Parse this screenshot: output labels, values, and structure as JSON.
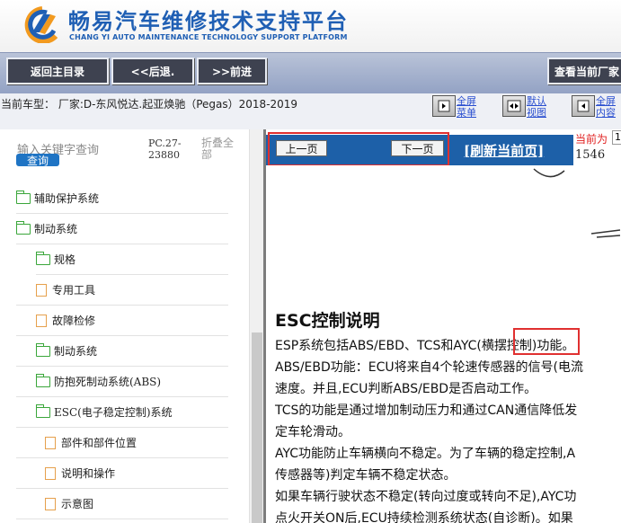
{
  "header": {
    "title_cn": "畅易汽车维修技术支持平台",
    "title_en": "CHANG YI AUTO MAINTENANCE TECHNOLOGY SUPPORT PLATFORM"
  },
  "toolbar": {
    "home_label": "返回主目录",
    "back_label": "<<后退.",
    "forward_label": ">>前进",
    "current_label": "查看当前厂家"
  },
  "infobar": {
    "model_text": "当前车型：  厂家:D-东风悦达.起亚焕驰（Pegas）2018-2019",
    "fullscreen_menu": "全屏菜单",
    "default_view": "默认视图",
    "fullscreen_content": "全屏内容"
  },
  "sidebar": {
    "search_hint": "输入关键字查询",
    "search_button": "查询",
    "pc_code": "PC.27-23880",
    "collapse_all": "折叠全部",
    "tree": [
      {
        "label": "辅助保护系统",
        "type": "folder"
      },
      {
        "label": "制动系统",
        "type": "folder"
      },
      {
        "label": "规格",
        "type": "folder"
      },
      {
        "label": "专用工具",
        "type": "file"
      },
      {
        "label": "故障检修",
        "type": "file"
      },
      {
        "label": "制动系统",
        "type": "folder"
      },
      {
        "label": "防抱死制动系统(ABS)",
        "type": "folder"
      },
      {
        "label": "ESC(电子稳定控制)系统",
        "type": "folder"
      },
      {
        "label": "部件和部件位置",
        "type": "file"
      },
      {
        "label": "说明和操作",
        "type": "file"
      },
      {
        "label": "示意图",
        "type": "file"
      }
    ]
  },
  "content": {
    "prev_button": "上一页",
    "next_button": "下一页",
    "refresh_link": "[刷新当前页]",
    "current_label": "当前为",
    "current_value": "1",
    "page_number": "1546",
    "doc_title": "ESC控制说明",
    "lines": [
      "ESP系统包括ABS/EBD、TCS和AYC(横摆控制)功能。",
      "ABS/EBD功能：ECU将来自4个轮速传感器的信号(电流",
      "速度。并且,ECU判断ABS/EBD是否启动工作。",
      "TCS的功能是通过增加制动压力和通过CAN通信降低发",
      "定车轮滑动。",
      "AYC功能防止车辆横向不稳定。为了车辆的稳定控制,A",
      "传感器等)判定车辆不稳定状态。",
      "如果车辆行驶状态不稳定(转向过度或转向不足),AYC功",
      "点火开关ON后,ECU持续检测系统状态(自诊断)。如果"
    ]
  },
  "colors": {
    "brand_blue": "#1f5fb4",
    "pager_bar": "#1d60a8",
    "highlight_red": "#e03030",
    "folder_green": "#3aa63a",
    "file_orange": "#e6a04c"
  }
}
